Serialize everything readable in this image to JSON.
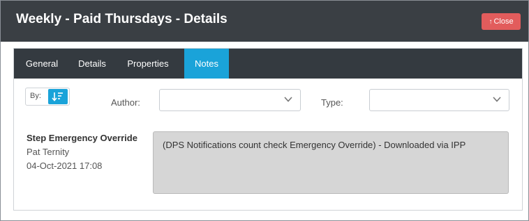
{
  "dialog": {
    "title": "Weekly - Paid Thursdays - Details",
    "close_label": "Close"
  },
  "tabs": [
    {
      "label": "General",
      "active": false
    },
    {
      "label": "Details",
      "active": false
    },
    {
      "label": "Properties",
      "active": false
    },
    {
      "label": "Notes",
      "active": true
    }
  ],
  "filters": {
    "sort_by_label": "By:",
    "author_label": "Author:",
    "author_value": "",
    "type_label": "Type:",
    "type_value": ""
  },
  "note": {
    "title": "Step Emergency Override",
    "author": "Pat Ternity",
    "date": "04-Oct-2021 17:08",
    "text": "(DPS Notifications count check Emergency Override) - Downloaded via IPP"
  },
  "colors": {
    "titlebar": "#3a3f44",
    "tabbar": "#343a40",
    "accent": "#1aa3d9",
    "close": "#e25c5c",
    "note_background": "#d6d6d6"
  }
}
